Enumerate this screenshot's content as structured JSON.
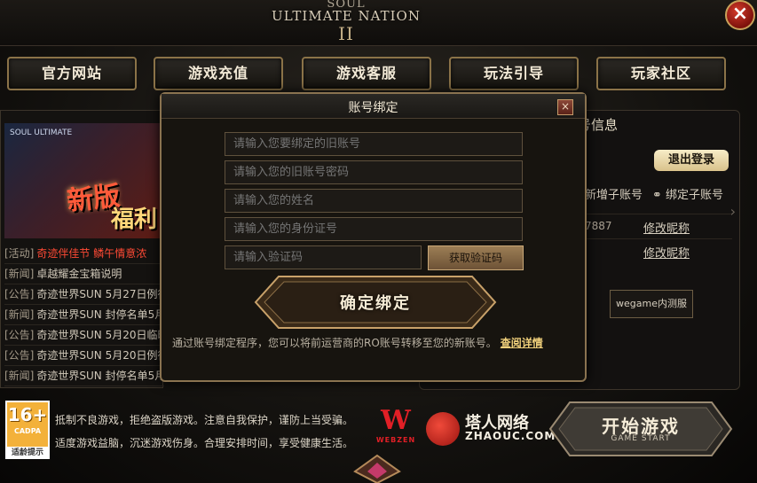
{
  "logo": {
    "line1": "SOUL",
    "line2": "ULTIMATE NATION",
    "line3": "II"
  },
  "window": {
    "close_glyph": "×"
  },
  "nav": [
    {
      "label": "官方网站"
    },
    {
      "label": "游戏充值"
    },
    {
      "label": "游戏客服"
    },
    {
      "label": "玩法引导"
    },
    {
      "label": "玩家社区"
    }
  ],
  "banner": {
    "top_text": "SOUL ULTIMATE",
    "text1": "新版",
    "text2": "福利"
  },
  "news": [
    {
      "tag": "[活动]",
      "title": "奇迹伴佳节 鳞午情意浓",
      "hot": true
    },
    {
      "tag": "[新闻]",
      "title": "卓越耀金宝箱说明",
      "hot": false
    },
    {
      "tag": "[公告]",
      "title": "奇迹世界SUN 5月27日例行维",
      "hot": false
    },
    {
      "tag": "[新闻]",
      "title": "奇迹世界SUN 封停名单5月1",
      "hot": false
    },
    {
      "tag": "[公告]",
      "title": "奇迹世界SUN 5月20日临时维",
      "hot": false
    },
    {
      "tag": "[公告]",
      "title": "奇迹世界SUN 5月20日例行维",
      "hot": false
    },
    {
      "tag": "[新闻]",
      "title": "奇迹世界SUN 封停名单5月1",
      "hot": false
    }
  ],
  "account_panel": {
    "title": "号信息",
    "logout_label": "退出登录",
    "add_sub": "新增子账号",
    "bind_sub": "绑定子账号",
    "rows": [
      {
        "code": "7887",
        "edit": "修改昵称"
      },
      {
        "code": "",
        "edit": "修改昵称"
      }
    ],
    "wegame_label": "wegame内测服",
    "arrow": "›"
  },
  "modal": {
    "title": "账号绑定",
    "close_glyph": "×",
    "fields": [
      {
        "placeholder": "请输入您要绑定的旧账号"
      },
      {
        "placeholder": "请输入您的旧账号密码"
      },
      {
        "placeholder": "请输入您的姓名"
      },
      {
        "placeholder": "请输入您的身份证号"
      },
      {
        "placeholder": "请输入验证码"
      }
    ],
    "get_code_label": "获取验证码",
    "confirm_label": "确定绑定",
    "note": "通过账号绑定程序，您可以将前运营商的RO账号转移至您的新账号。",
    "note_link": "查阅详情"
  },
  "footer": {
    "age_rating": "16+",
    "age_org": "CADPA",
    "age_tip": "适龄提示",
    "notice_line1": "抵制不良游戏，拒绝盗版游戏。注意自我保护，谨防上当受骗。",
    "notice_line2": "适度游戏益脑，沉迷游戏伤身。合理安排时间，享受健康生活。",
    "webzen_mark": "W",
    "webzen_text": "WEBZEN",
    "zhaouc_name": "塔人网络",
    "zhaouc_url": "ZHAOUC.COM",
    "start_label": "开始游戏",
    "start_sub": "GAME START"
  },
  "colors": {
    "gold": "#8b7348",
    "accent_red": "#ff4a35",
    "link_gold": "#f0d07b"
  }
}
